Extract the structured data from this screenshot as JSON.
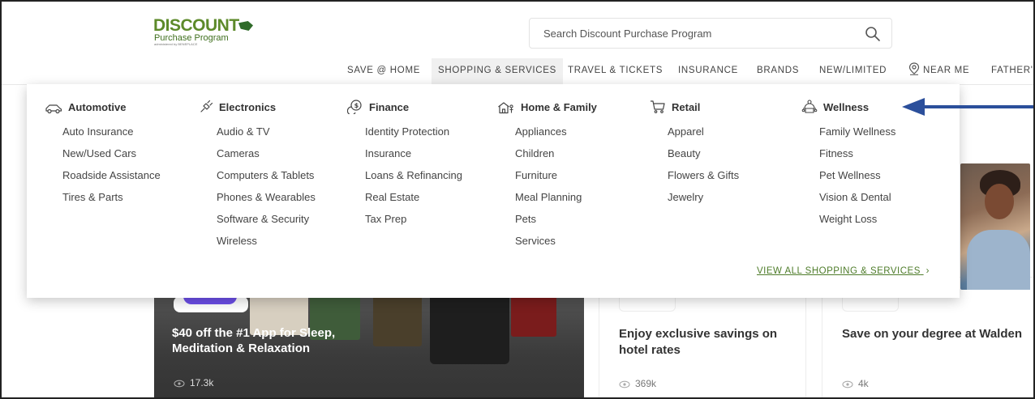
{
  "logo": {
    "line1": "DISCOUNT",
    "line2": "Purchase Program",
    "line3": "administered by BENEPLACE"
  },
  "search": {
    "placeholder": "Search Discount Purchase Program"
  },
  "nav": {
    "items": [
      "SAVE @ HOME",
      "SHOPPING & SERVICES",
      "TRAVEL & TICKETS",
      "INSURANCE",
      "BRANDS",
      "NEW/LIMITED",
      "NEAR ME",
      "FATHER'S"
    ],
    "active": "SHOPPING & SERVICES"
  },
  "menu": {
    "categories": [
      {
        "title": "Automotive",
        "icon": "car-icon",
        "items": [
          "Auto Insurance",
          "New/Used Cars",
          "Roadside Assistance",
          "Tires & Parts"
        ]
      },
      {
        "title": "Electronics",
        "icon": "plug-icon",
        "items": [
          "Audio & TV",
          "Cameras",
          "Computers & Tablets",
          "Phones & Wearables",
          "Software & Security",
          "Wireless"
        ]
      },
      {
        "title": "Finance",
        "icon": "coins-icon",
        "items": [
          "Identity Protection",
          "Insurance",
          "Loans & Refinancing",
          "Real Estate",
          "Tax Prep"
        ]
      },
      {
        "title": "Home & Family",
        "icon": "house-icon",
        "items": [
          "Appliances",
          "Children",
          "Furniture",
          "Meal Planning",
          "Pets",
          "Services"
        ]
      },
      {
        "title": "Retail",
        "icon": "cart-icon",
        "items": [
          "Apparel",
          "Beauty",
          "Flowers & Gifts",
          "Jewelry"
        ]
      },
      {
        "title": "Wellness",
        "icon": "wellness-icon",
        "items": [
          "Family Wellness",
          "Fitness",
          "Pet Wellness",
          "Vision & Dental",
          "Weight Loss"
        ]
      }
    ],
    "view_all": "VIEW ALL SHOPPING & SERVICES"
  },
  "cards": [
    {
      "title": "$40 off the #1 App for Sleep, Meditation & Relaxation",
      "views": "17.3k"
    },
    {
      "title": "Enjoy exclusive savings on hotel rates",
      "views": "369k"
    },
    {
      "title": "Save on your degree at Walden",
      "views": "4k"
    }
  ],
  "colors": {
    "brand_green": "#5d8a2a",
    "link_green": "#4e7c2a",
    "arrow_blue": "#2b4f9b"
  }
}
